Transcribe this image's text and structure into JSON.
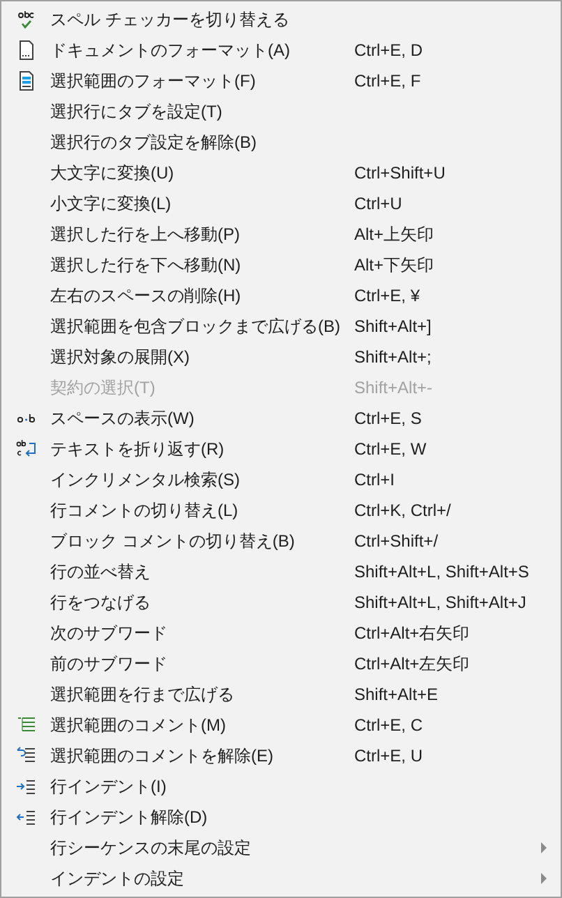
{
  "menu": {
    "items": [
      {
        "label": "スペル チェッカーを切り替える",
        "kind": "spell-check",
        "disabled": false,
        "submenu": false
      },
      {
        "label": "ドキュメントのフォーマット(A)",
        "shortcut": "Ctrl+E, D",
        "kind": "document",
        "disabled": false,
        "submenu": false
      },
      {
        "label": "選択範囲のフォーマット(F)",
        "shortcut": "Ctrl+E, F",
        "kind": "selection",
        "disabled": false,
        "submenu": false
      },
      {
        "label": "選択行にタブを設定(T)",
        "kind": "plain",
        "disabled": false,
        "submenu": false
      },
      {
        "label": "選択行のタブ設定を解除(B)",
        "kind": "plain",
        "disabled": false,
        "submenu": false
      },
      {
        "label": "大文字に変換(U)",
        "shortcut": "Ctrl+Shift+U",
        "kind": "plain",
        "disabled": false,
        "submenu": false
      },
      {
        "label": "小文字に変換(L)",
        "shortcut": "Ctrl+U",
        "kind": "plain",
        "disabled": false,
        "submenu": false
      },
      {
        "label": "選択した行を上へ移動(P)",
        "shortcut": "Alt+上矢印",
        "kind": "plain",
        "disabled": false,
        "submenu": false
      },
      {
        "label": "選択した行を下へ移動(N)",
        "shortcut": "Alt+下矢印",
        "kind": "plain",
        "disabled": false,
        "submenu": false
      },
      {
        "label": "左右のスペースの削除(H)",
        "shortcut": "Ctrl+E, ¥",
        "kind": "plain",
        "disabled": false,
        "submenu": false
      },
      {
        "label": "選択範囲を包含ブロックまで広げる(B)",
        "shortcut": "Shift+Alt+]",
        "kind": "plain",
        "disabled": false,
        "submenu": false
      },
      {
        "label": "選択対象の展開(X)",
        "shortcut": "Shift+Alt+;",
        "kind": "plain",
        "disabled": false,
        "submenu": false
      },
      {
        "label": "契約の選択(T)",
        "shortcut": "Shift+Alt+-",
        "kind": "plain",
        "disabled": true,
        "submenu": false
      },
      {
        "label": "スペースの表示(W)",
        "shortcut": "Ctrl+E, S",
        "kind": "whitespace",
        "disabled": false,
        "submenu": false
      },
      {
        "label": "テキストを折り返す(R)",
        "shortcut": "Ctrl+E, W",
        "kind": "wrap",
        "disabled": false,
        "submenu": false
      },
      {
        "label": "インクリメンタル検索(S)",
        "shortcut": "Ctrl+I",
        "kind": "plain",
        "disabled": false,
        "submenu": false
      },
      {
        "label": "行コメントの切り替え(L)",
        "shortcut": "Ctrl+K, Ctrl+/",
        "kind": "plain",
        "disabled": false,
        "submenu": false
      },
      {
        "label": "ブロック コメントの切り替え(B)",
        "shortcut": "Ctrl+Shift+/",
        "kind": "plain",
        "disabled": false,
        "submenu": false
      },
      {
        "label": "行の並べ替え",
        "shortcut": "Shift+Alt+L, Shift+Alt+S",
        "kind": "plain",
        "disabled": false,
        "submenu": false
      },
      {
        "label": "行をつなげる",
        "shortcut": "Shift+Alt+L, Shift+Alt+J",
        "kind": "plain",
        "disabled": false,
        "submenu": false
      },
      {
        "label": "次のサブワード",
        "shortcut": "Ctrl+Alt+右矢印",
        "kind": "plain",
        "disabled": false,
        "submenu": false
      },
      {
        "label": "前のサブワード",
        "shortcut": "Ctrl+Alt+左矢印",
        "kind": "plain",
        "disabled": false,
        "submenu": false
      },
      {
        "label": "選択範囲を行まで広げる",
        "shortcut": "Shift+Alt+E",
        "kind": "plain",
        "disabled": false,
        "submenu": false
      },
      {
        "label": "選択範囲のコメント(M)",
        "shortcut": "Ctrl+E, C",
        "kind": "comment",
        "disabled": false,
        "submenu": false
      },
      {
        "label": "選択範囲のコメントを解除(E)",
        "shortcut": "Ctrl+E, U",
        "kind": "uncomment",
        "disabled": false,
        "submenu": false
      },
      {
        "label": "行インデント(I)",
        "kind": "indent",
        "disabled": false,
        "submenu": false
      },
      {
        "label": "行インデント解除(D)",
        "kind": "outdent",
        "disabled": false,
        "submenu": false
      },
      {
        "label": "行シーケンスの末尾の設定",
        "kind": "plain",
        "disabled": false,
        "submenu": true
      },
      {
        "label": "インデントの設定",
        "kind": "plain",
        "disabled": false,
        "submenu": true
      }
    ]
  }
}
